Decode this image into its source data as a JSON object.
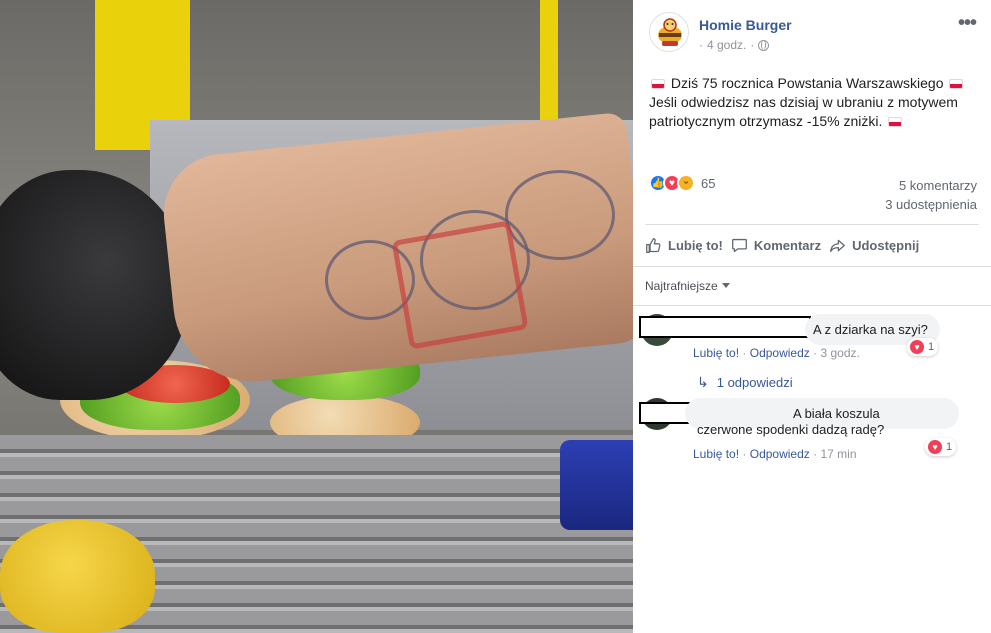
{
  "post": {
    "page_name": "Homie Burger",
    "time": "4 godz.",
    "text_line1": "Dziś 75 rocznica Powstania Warszawskiego",
    "text_line2": "Jeśli odwiedzisz nas dzisiaj w ubraniu z motywem patriotycznym otrzymasz -15% zniżki.",
    "reactions_count": "65",
    "comments_count": "5 komentarzy",
    "shares_count": "3 udostępnienia"
  },
  "actions": {
    "like": "Lubię to!",
    "comment": "Komentarz",
    "share": "Udostępnij"
  },
  "filter": {
    "label": "Najtrafniejsze"
  },
  "comments": [
    {
      "text": "A z dziarka na szyi?",
      "reaction_count": "1",
      "like_label": "Lubię to!",
      "reply_label": "Odpowiedz",
      "time": "3 godz.",
      "replies_label": "1 odpowiedzi"
    },
    {
      "text_line1": "A biała koszula",
      "text_line2": "czerwone spodenki dadzą radę?",
      "reaction_count": "1",
      "like_label": "Lubię to!",
      "reply_label": "Odpowiedz",
      "time": "17 min"
    }
  ],
  "icons": {
    "more": "more-horizontal-icon",
    "audience": "globe-icon",
    "like": "thumbs-up-icon",
    "comment": "speech-bubble-icon",
    "share": "share-arrow-icon"
  },
  "colors": {
    "link_blue": "#385898",
    "like_blue": "#1877f2",
    "love_red": "#f33e58",
    "haha_yellow": "#f7b125"
  }
}
